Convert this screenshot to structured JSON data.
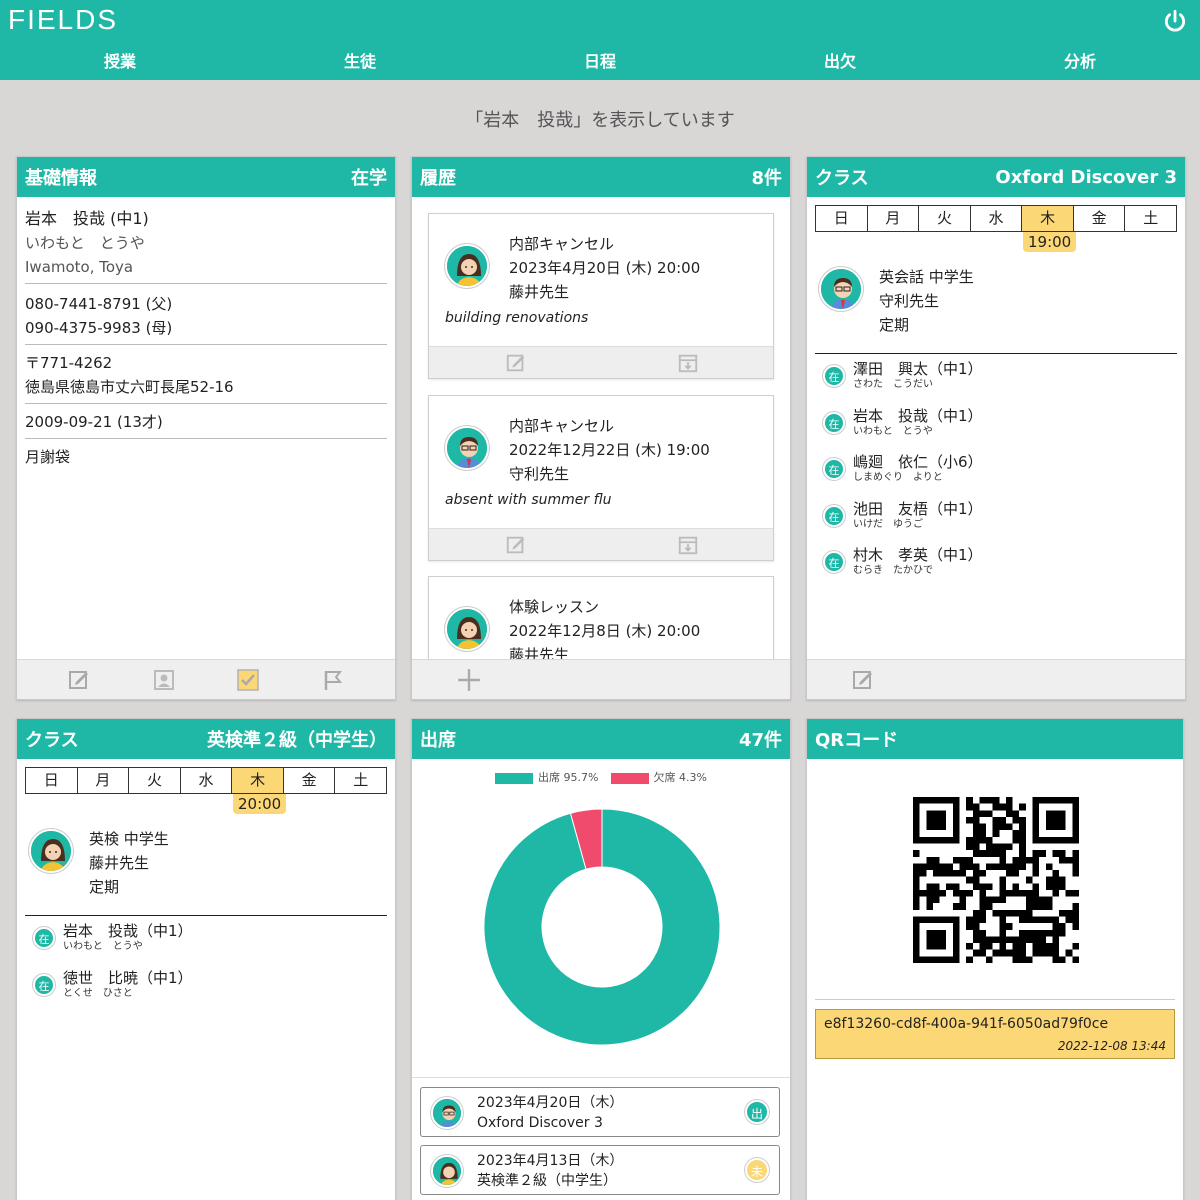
{
  "app": {
    "logo": "FIELDS",
    "power_icon": "power-icon",
    "accent": "#1fb8a6",
    "highlight": "#fcd776",
    "absent_color": "#f04a6c"
  },
  "nav": [
    "授業",
    "生徒",
    "日程",
    "出欠",
    "分析"
  ],
  "subtitle": "「岩本　投哉」を表示しています",
  "basic": {
    "title": "基礎情報",
    "status": "在学",
    "name": "岩本　投哉 (中1)",
    "kana": "いわもと　とうや",
    "roman": "Iwamoto, Toya",
    "phone1": "080-7441-8791 (父)",
    "phone2": "090-4375-9983 (母)",
    "postal": "〒771-4262",
    "address": "徳島県徳島市丈六町長尾52-16",
    "birth": "2009-09-21 (13才)",
    "payment": "月謝袋"
  },
  "history": {
    "title": "履歴",
    "count": "8件",
    "items": [
      {
        "type": "内部キャンセル",
        "date": "2023年4月20日 (木) 20:00",
        "teacher": "藤井先生",
        "note": "building renovations",
        "avatar": "female-teacher-avatar"
      },
      {
        "type": "内部キャンセル",
        "date": "2022年12月22日 (木) 19:00",
        "teacher": "守利先生",
        "note": "absent with summer flu",
        "avatar": "male-teacher-avatar"
      },
      {
        "type": "体験レッスン",
        "date": "2022年12月8日 (木) 20:00",
        "teacher": "藤井先生",
        "note": "",
        "avatar": "female-teacher-avatar"
      }
    ]
  },
  "class1": {
    "title": "クラス",
    "name": "Oxford Discover 3",
    "days": [
      "日",
      "月",
      "火",
      "水",
      "木",
      "金",
      "土"
    ],
    "active_day": 4,
    "time": "19:00",
    "course": "英会話 中学生",
    "teacher": "守利先生",
    "kind": "定期",
    "students": [
      {
        "badge": "在",
        "name": "澤田　興太（中1）",
        "kana": "さわた　こうだい"
      },
      {
        "badge": "在",
        "name": "岩本　投哉（中1）",
        "kana": "いわもと　とうや"
      },
      {
        "badge": "在",
        "name": "嶋廻　依仁（小6）",
        "kana": "しまめぐり　よりと"
      },
      {
        "badge": "在",
        "name": "池田　友梧（中1）",
        "kana": "いけだ　ゆうご"
      },
      {
        "badge": "在",
        "name": "村木　孝英（中1）",
        "kana": "むらき　たかひで"
      }
    ]
  },
  "class2": {
    "title": "クラス",
    "name": "英検準２級（中学生）",
    "days": [
      "日",
      "月",
      "火",
      "水",
      "木",
      "金",
      "土"
    ],
    "active_day": 4,
    "time": "20:00",
    "course": "英検 中学生",
    "teacher": "藤井先生",
    "kind": "定期",
    "students": [
      {
        "badge": "在",
        "name": "岩本　投哉（中1）",
        "kana": "いわもと　とうや"
      },
      {
        "badge": "在",
        "name": "徳世　比暁（中1）",
        "kana": "とくせ　ひさと"
      }
    ]
  },
  "attendance": {
    "title": "出席",
    "count": "47件",
    "legend": [
      {
        "label": "出席 95.7%",
        "color": "#1fb8a6"
      },
      {
        "label": "欠席 4.3%",
        "color": "#f04a6c"
      }
    ],
    "items": [
      {
        "date": "2023年4月20日（木）",
        "class": "Oxford Discover 3",
        "status": "出",
        "status_color": "#1fb8a6",
        "avatar": "male-teacher-avatar"
      },
      {
        "date": "2023年4月13日（木）",
        "class": "英検準２級（中学生）",
        "status": "未",
        "status_color": "#fcd776",
        "avatar": "female-teacher-avatar"
      }
    ]
  },
  "chart_data": {
    "type": "pie",
    "style": "donut",
    "categories": [
      "出席",
      "欠席"
    ],
    "values": [
      95.7,
      4.3
    ],
    "colors": [
      "#1fb8a6",
      "#f04a6c"
    ],
    "legend": "top"
  },
  "qr": {
    "title": "QRコード",
    "code": "e8f13260-cd8f-400a-941f-6050ad79f0ce",
    "timestamp": "2022-12-08 13:44"
  }
}
